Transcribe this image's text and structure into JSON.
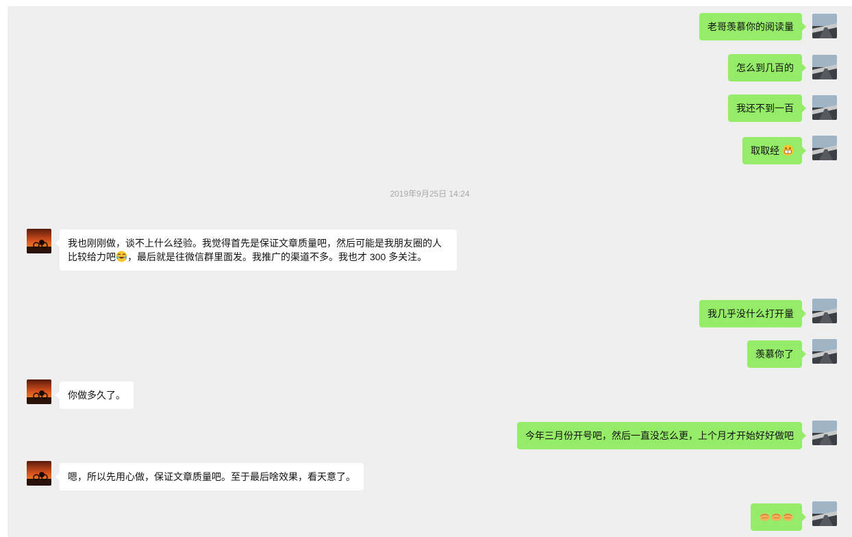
{
  "timestamp": "2019年9月25日 14:24",
  "messages": [
    {
      "side": "me",
      "text": "老哥羡慕你的阅读量"
    },
    {
      "side": "me",
      "text": "怎么到几百的"
    },
    {
      "side": "me",
      "text": "我还不到一百"
    },
    {
      "side": "me",
      "text": "取取经",
      "emoji": "grinning-emoji"
    },
    {
      "side": "other",
      "text_a": "我也刚刚做，谈不上什么经验。我觉得首先是保证文章质量吧，然后可能是我朋友圈的人比较给力吧",
      "emoji": "laughing-tears-emoji",
      "text_b": "，最后就是往微信群里面发。我推广的渠道不多。我也才 300 多关注。"
    },
    {
      "side": "me",
      "text": "我几乎没什么打开量"
    },
    {
      "side": "me",
      "text": "羡慕你了"
    },
    {
      "side": "other",
      "text": "你做多久了。"
    },
    {
      "side": "me",
      "text": "今年三月份开号吧，然后一直没怎么更，上个月才开始好好做吧"
    },
    {
      "side": "other",
      "text": "嗯，所以先用心做，保证文章质量吧。至于最后啥效果，看天意了。"
    },
    {
      "side": "me",
      "emoji": "fist-emoji"
    }
  ],
  "colors": {
    "background": "#efefef",
    "me_bubble": "#95ec69",
    "other_bubble": "#ffffff",
    "timestamp": "#a8a8a8"
  },
  "icons": {
    "me_avatar": "road-photo-avatar",
    "other_avatar": "sunset-cyclist-avatar"
  }
}
